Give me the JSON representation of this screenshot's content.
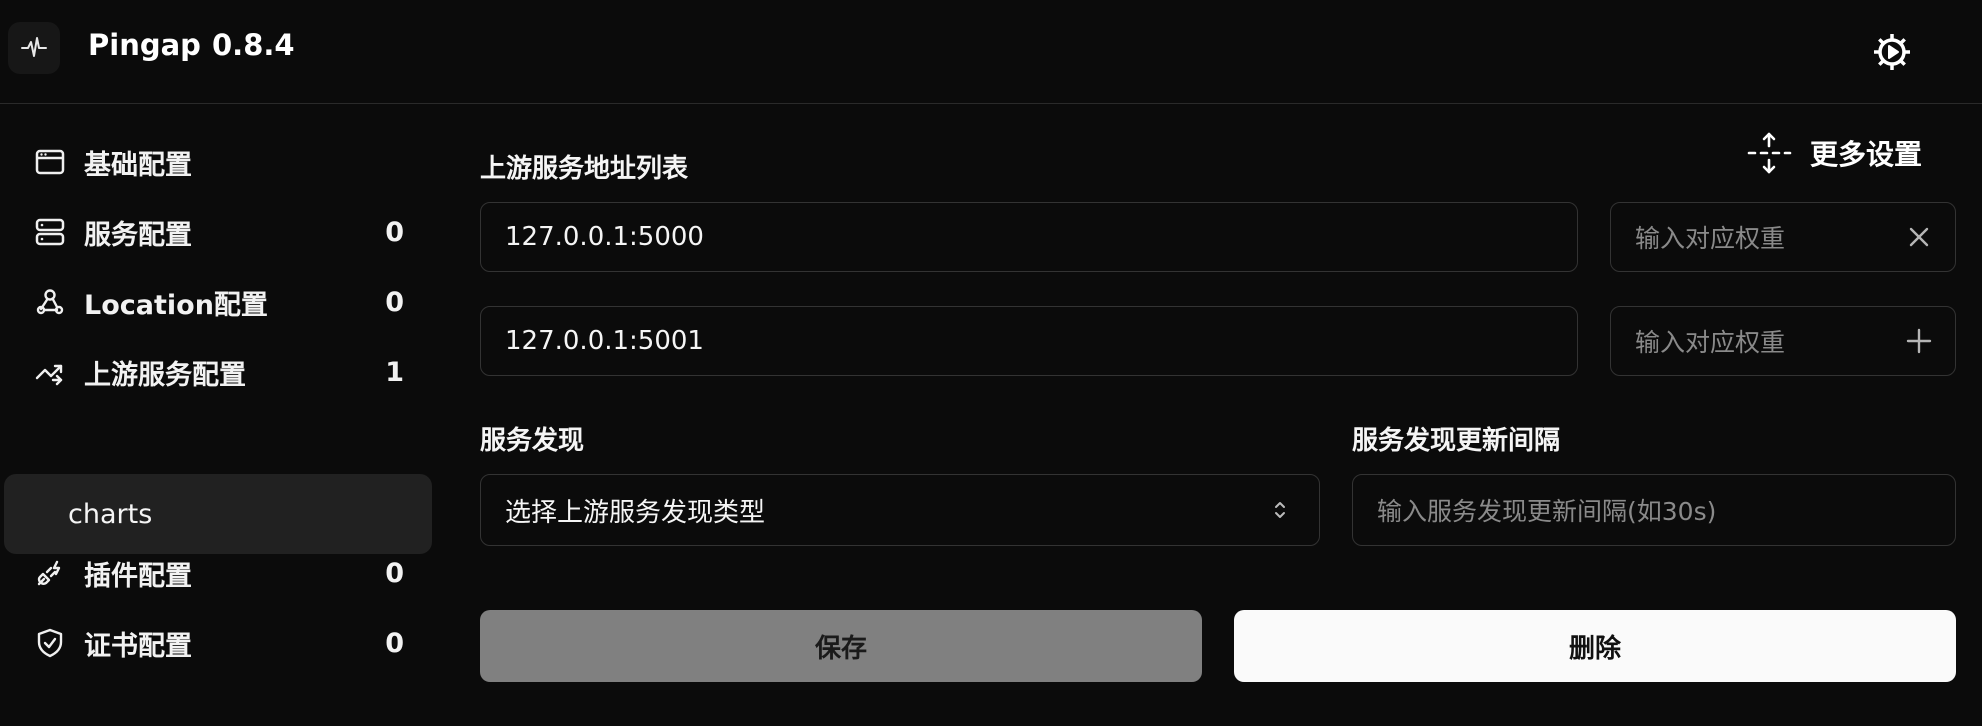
{
  "header": {
    "app_name": "Pingap",
    "version": "0.8.4",
    "logo_icon": "pulse-icon",
    "settings_icon": "gear-icon"
  },
  "sidebar": {
    "items": [
      {
        "label": "基础配置",
        "count": "",
        "icon": "browser-window-icon"
      },
      {
        "label": "服务配置",
        "count": "0",
        "icon": "server-icon"
      },
      {
        "label": "Location配置",
        "count": "0",
        "icon": "webhook-icon"
      },
      {
        "label": "上游服务配置",
        "count": "1",
        "icon": "shuffle-icon"
      },
      {
        "label": "charts",
        "count": "",
        "icon": ""
      },
      {
        "label": "插件配置",
        "count": "0",
        "icon": "plug-icon"
      },
      {
        "label": "证书配置",
        "count": "0",
        "icon": "shield-check-icon"
      }
    ]
  },
  "main": {
    "upstream_list_label": "上游服务地址列表",
    "more_settings_label": "更多设置",
    "more_settings_icon": "expand-vertical-icon",
    "addresses": [
      {
        "value": "127.0.0.1:5000",
        "weight_placeholder": "输入对应权重",
        "action_icon": "close-icon"
      },
      {
        "value": "127.0.0.1:5001",
        "weight_placeholder": "输入对应权重",
        "action_icon": "plus-icon"
      }
    ],
    "discovery_label": "服务发现",
    "discovery_select_value": "选择上游服务发现类型",
    "discovery_interval_label": "服务发现更新间隔",
    "discovery_interval_placeholder": "输入服务发现更新间隔(如30s)",
    "save_label": "保存",
    "delete_label": "删除"
  },
  "colors": {
    "background": "#0b0b0b",
    "border": "#333333",
    "active_item_bg": "#212121",
    "save_button_bg": "#808080",
    "delete_button_bg": "#fafafa"
  }
}
